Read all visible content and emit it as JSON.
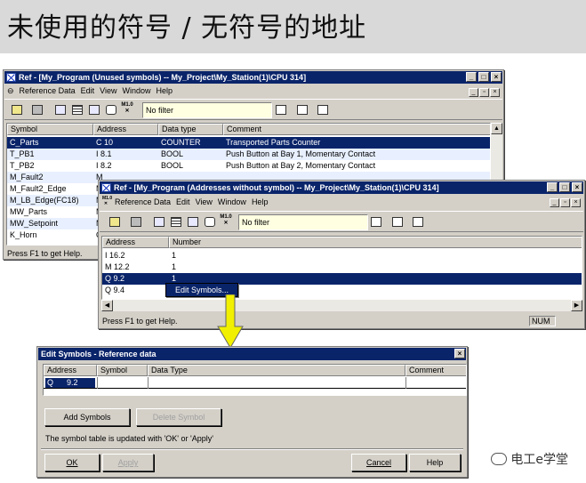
{
  "header": {
    "title": "未使用的符号 / 无符号的地址"
  },
  "win1": {
    "title": "Ref - [My_Program (Unused symbols) -- My_Project\\My_Station(1)\\CPU 314]",
    "menu": [
      "Reference Data",
      "Edit",
      "View",
      "Window",
      "Help"
    ],
    "filter": "No filter",
    "columns": [
      "Symbol",
      "Address",
      "Data type",
      "Comment"
    ],
    "rows": [
      [
        "C_Parts",
        "C 10",
        "COUNTER",
        "Transported Parts Counter"
      ],
      [
        "T_PB1",
        "I 8.1",
        "BOOL",
        "Push Button at Bay 1, Momentary Contact"
      ],
      [
        "T_PB2",
        "I 8.2",
        "BOOL",
        "Push Button at Bay 2, Momentary Contact"
      ],
      [
        "M_Fault2",
        "M",
        "",
        ""
      ],
      [
        "M_Fault2_Edge",
        "M",
        "",
        ""
      ],
      [
        "M_LB_Edge(FC18)",
        "M",
        "",
        ""
      ],
      [
        "MW_Parts",
        "M",
        "",
        ""
      ],
      [
        "MW_Setpoint",
        "M",
        "",
        ""
      ],
      [
        "K_Horn",
        "Q",
        "",
        ""
      ]
    ],
    "status": "Press F1 to get Help."
  },
  "win2": {
    "title": "Ref - [My_Program (Addresses without symbol) -- My_Project\\My_Station(1)\\CPU 314]",
    "menu": [
      "Reference Data",
      "Edit",
      "View",
      "Window",
      "Help"
    ],
    "filter": "No filter",
    "columns": [
      "Address",
      "Number"
    ],
    "rows": [
      [
        "I 16.2",
        "1"
      ],
      [
        "M 12.2",
        "1"
      ],
      [
        "Q 9.2",
        "1"
      ],
      [
        "Q 9.4",
        ""
      ]
    ],
    "context_menu": "Edit Symbols...",
    "status": "Press F1 to get Help.",
    "num_indicator": "NUM"
  },
  "dialog": {
    "title": "Edit Symbols - Reference data",
    "columns": [
      "Address",
      "Symbol",
      "Data Type",
      "Comment"
    ],
    "row": {
      "addr_type": "Q",
      "addr_num": "9.2",
      "symbol": "",
      "datatype": "",
      "comment": ""
    },
    "add_symbols": "Add Symbols",
    "delete_symbol": "Delete Symbol",
    "info": "The symbol table is updated with 'OK' or 'Apply'",
    "ok": "OK",
    "apply": "Apply",
    "cancel": "Cancel",
    "help": "Help"
  },
  "watermark": "电工e学堂",
  "colors": {
    "titlebar": "#0a246a",
    "face": "#d4d0c8",
    "arrow": "#f0f000"
  }
}
